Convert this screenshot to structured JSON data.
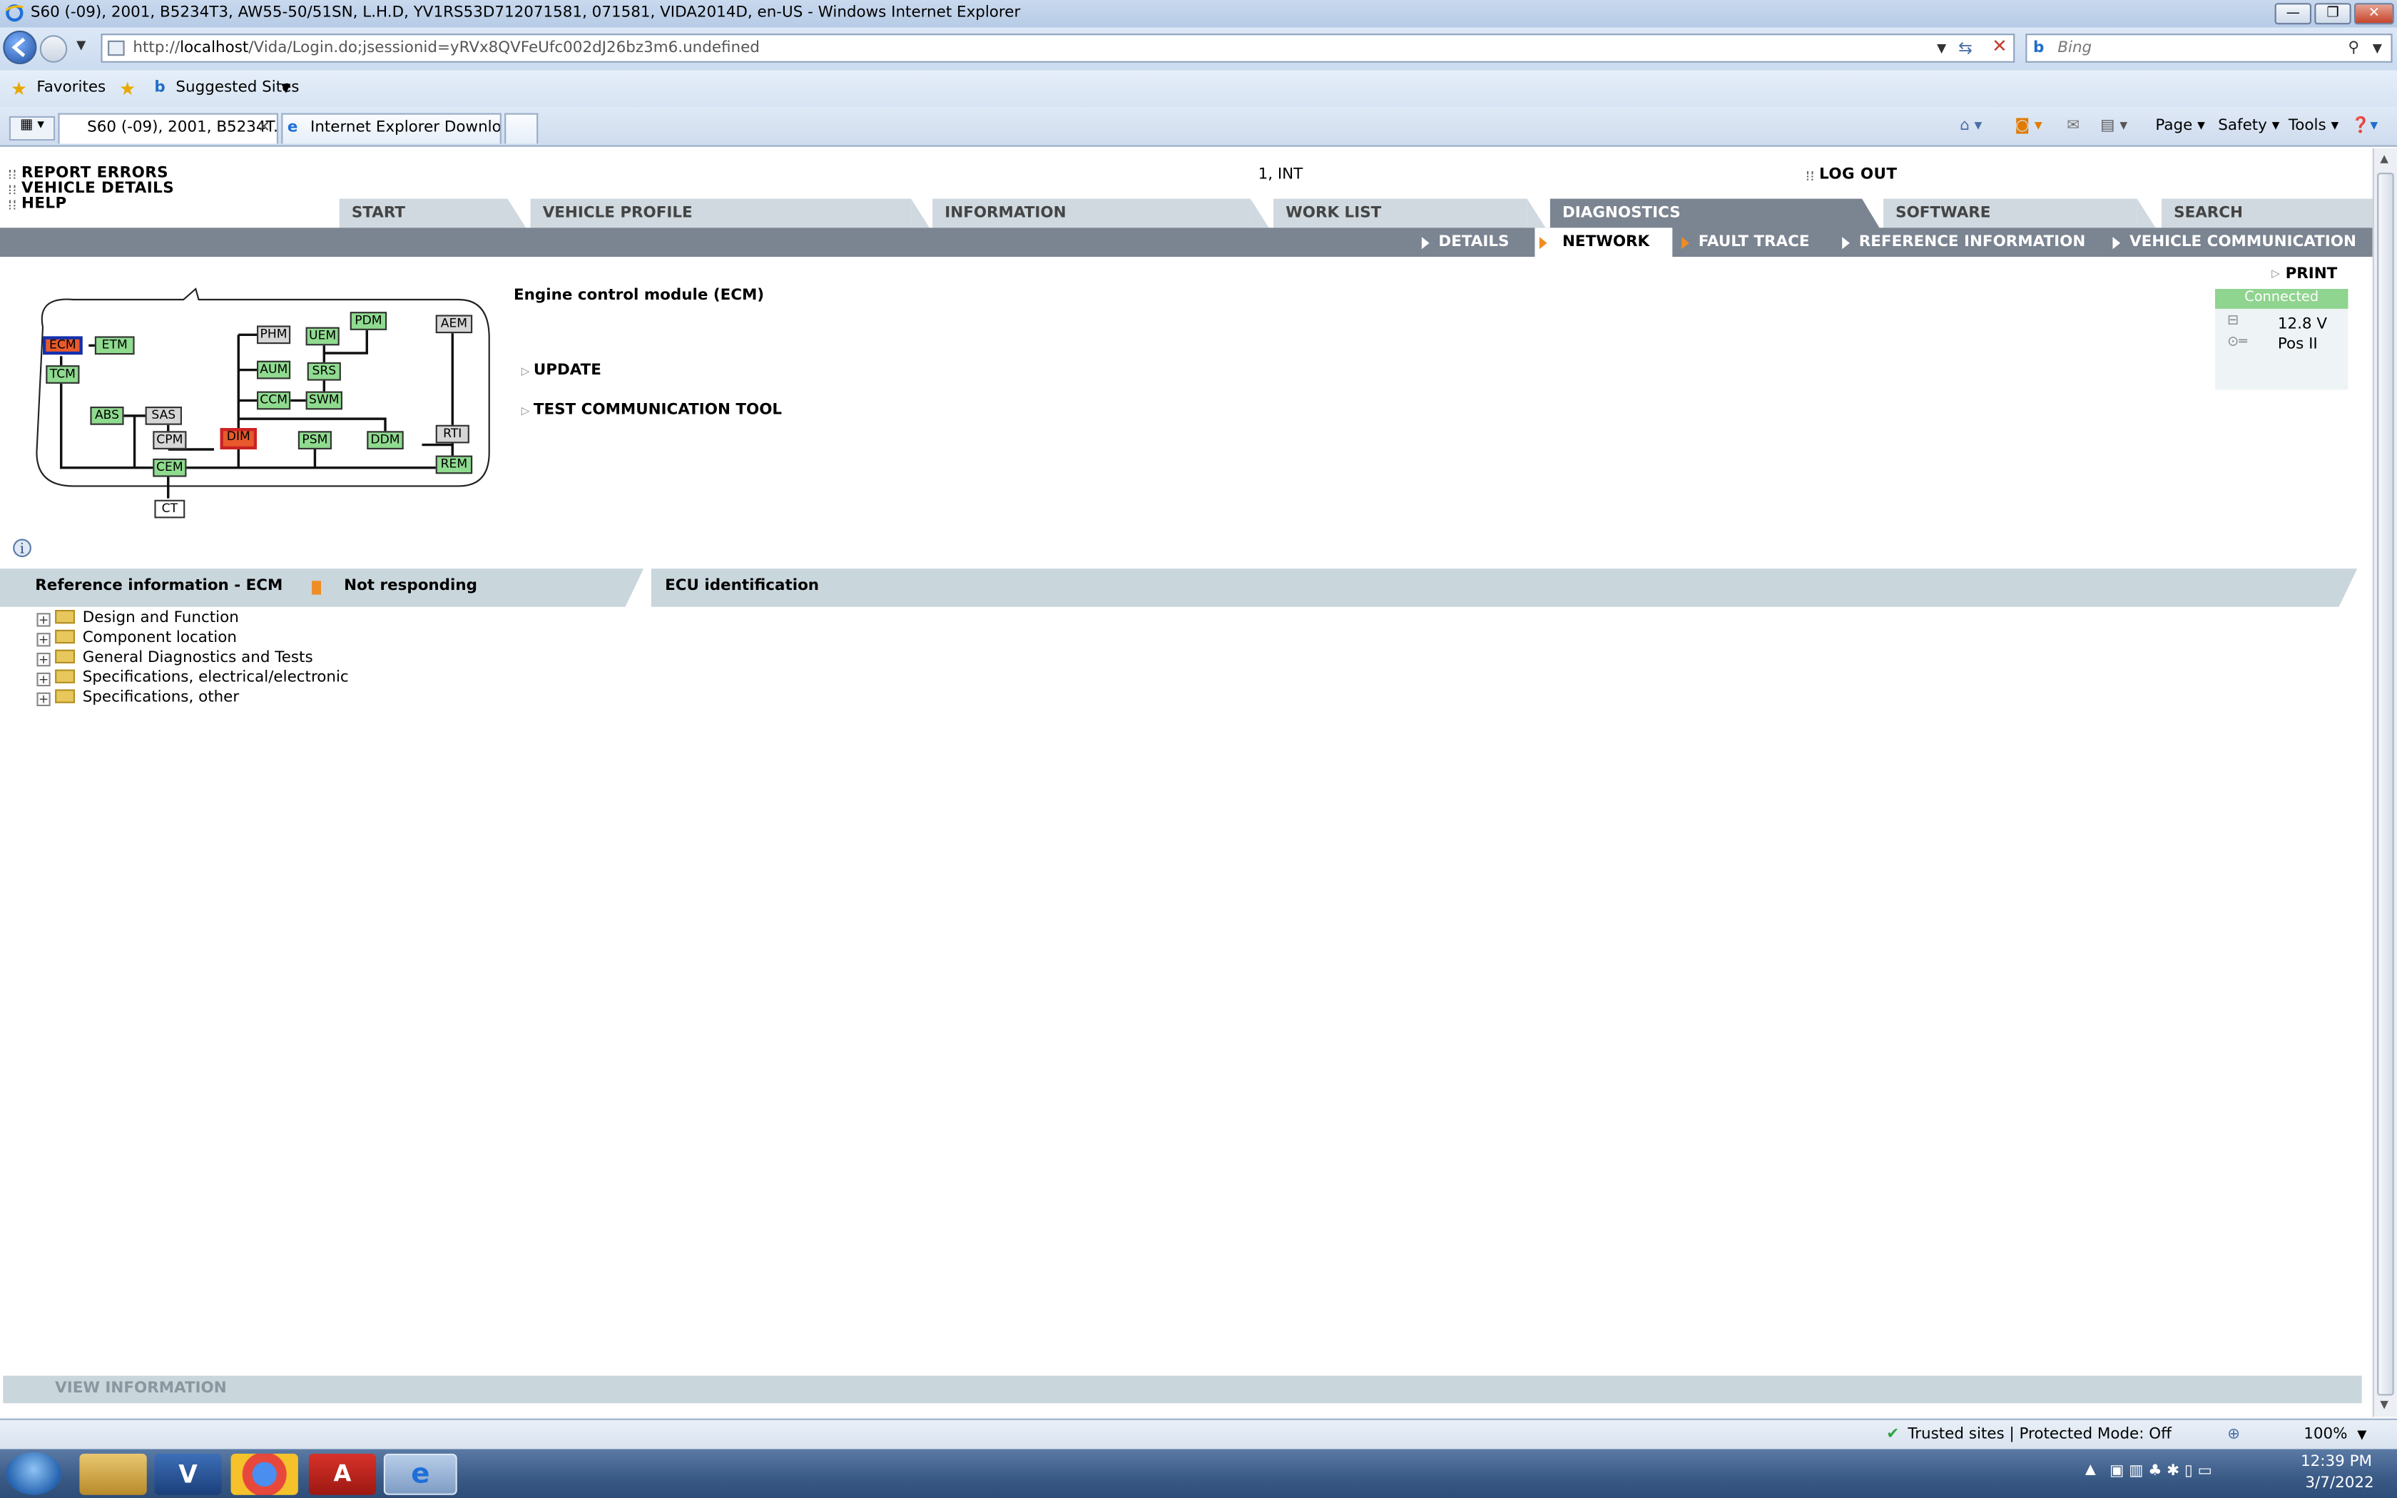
{
  "window": {
    "title": "S60 (-09), 2001, B5234T3, AW55-50/51SN, L.H.D, YV1RS53D712071581, 071581, VIDA2014D, en-US - Windows Internet Explorer"
  },
  "address": {
    "prefix": "http://",
    "host": "localhost",
    "path": "/Vida/Login.do;jsessionid=yRVx8QVFeUfc002dJ26bz3m6.undefined",
    "search_placeholder": "Bing"
  },
  "favbar": {
    "favorites": "Favorites",
    "suggested": "Suggested Sites"
  },
  "tabs": [
    {
      "label": "S60 (-09), 2001, B5234T..."
    },
    {
      "label": "Internet Explorer Downloads"
    }
  ],
  "commandbar": {
    "page": "Page",
    "safety": "Safety",
    "tools": "Tools"
  },
  "vida": {
    "links": {
      "report_errors": "REPORT ERRORS",
      "vehicle_details": "VEHICLE DETAILS",
      "help": "HELP",
      "user": "1, INT",
      "logout": "LOG OUT"
    },
    "main_tabs": [
      "START",
      "VEHICLE PROFILE",
      "INFORMATION",
      "WORK LIST",
      "DIAGNOSTICS",
      "SOFTWARE",
      "SEARCH"
    ],
    "sub_tabs": [
      "DETAILS",
      "NETWORK",
      "FAULT TRACE",
      "REFERENCE INFORMATION",
      "VEHICLE COMMUNICATION"
    ],
    "print": "PRINT",
    "connection": {
      "status": "Connected",
      "voltage": "12.8 V",
      "ignition": "Pos II"
    },
    "module_title": "Engine control module (ECM)",
    "actions": [
      "UPDATE",
      "TEST COMMUNICATION TOOL"
    ],
    "ecus": [
      "ECM",
      "ETM",
      "TCM",
      "ABS",
      "SAS",
      "CPM",
      "CEM",
      "CT",
      "DIM",
      "PHM",
      "UEM",
      "PDM",
      "AUM",
      "SRS",
      "CCM",
      "SWM",
      "PSM",
      "DDM",
      "AEM",
      "RTI",
      "REM"
    ],
    "ref_panel": {
      "title": "Reference information - ECM",
      "status": "Not responding",
      "ecu_title": "ECU identification"
    },
    "tree": [
      "Design and Function",
      "Component location",
      "General Diagnostics and Tests",
      "Specifications, electrical/electronic",
      "Specifications, other"
    ],
    "view_information": "VIEW INFORMATION"
  },
  "statusbar": {
    "zone": "Trusted sites | Protected Mode: Off",
    "zoom": "100%"
  },
  "taskbar": {
    "time": "12:39 PM",
    "date": "3/7/2022"
  }
}
